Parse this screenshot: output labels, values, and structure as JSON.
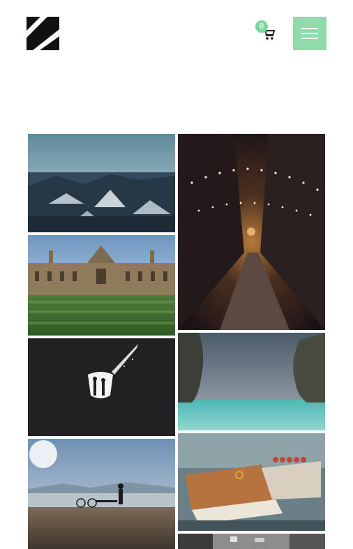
{
  "header": {
    "logo_icon": "logo-mark-icon",
    "cart": {
      "count": "0",
      "icon": "shopping-cart-icon"
    },
    "menu_icon": "hamburger-menu-icon",
    "accent_color": "#8fdcaa"
  },
  "gallery": {
    "items": [
      {
        "subject": "snowy-city-rooftops"
      },
      {
        "subject": "string-lights-alley-night"
      },
      {
        "subject": "college-building-lawn"
      },
      {
        "subject": "silhouettes-in-cave"
      },
      {
        "subject": "sea-cliffs-stormy-sky"
      },
      {
        "subject": "person-with-bicycle-at-lake"
      },
      {
        "subject": "boats-in-harbor"
      },
      {
        "subject": "black-and-white-street"
      }
    ]
  }
}
